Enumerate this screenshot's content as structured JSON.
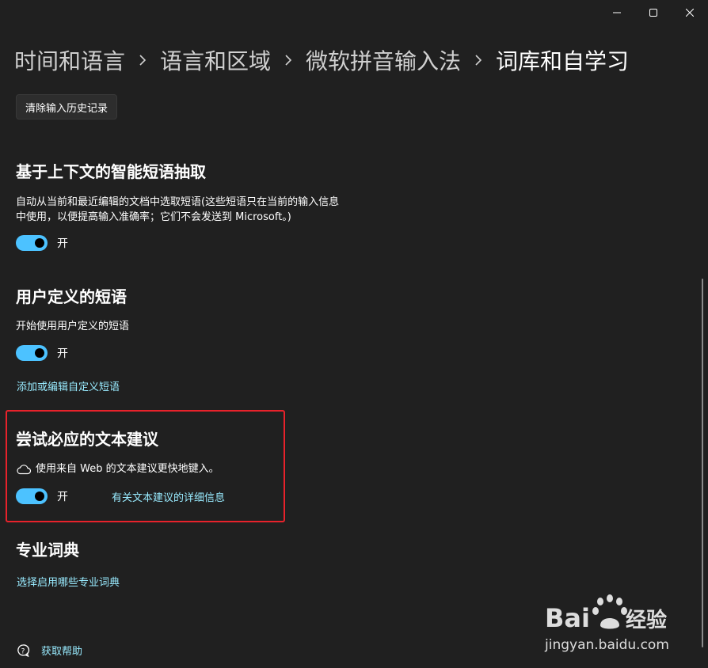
{
  "titlebar": {
    "minimize_icon": "minimize-icon",
    "maximize_icon": "maximize-icon",
    "close_icon": "close-icon"
  },
  "breadcrumb": {
    "items": [
      "时间和语言",
      "语言和区域",
      "微软拼音输入法",
      "词库和自学习"
    ]
  },
  "clear_history_button": "清除输入历史记录",
  "context_phrases": {
    "title": "基于上下文的智能短语抽取",
    "desc_line1": "自动从当前和最近编辑的文档中选取短语(这些短语只在当前的输入信息",
    "desc_line2": "中使用，以便提高输入准确率；它们不会发送到 Microsoft。)",
    "toggle_label": "开",
    "toggle_on": true
  },
  "user_phrases": {
    "title": "用户定义的短语",
    "desc": "开始使用用户定义的短语",
    "toggle_label": "开",
    "toggle_on": true,
    "link": "添加或编辑自定义短语"
  },
  "bing_suggestions": {
    "title": "尝试必应的文本建议",
    "desc": "使用来自 Web 的文本建议更快地键入。",
    "icon": "cloud-icon",
    "toggle_label": "开",
    "toggle_on": true,
    "link": "有关文本建议的详细信息",
    "highlight_color": "#e8222b"
  },
  "dictionaries": {
    "title": "专业词典",
    "link": "选择启用哪些专业词典"
  },
  "help": {
    "label": "获取帮助",
    "icon": "help-chat-icon"
  },
  "watermark": {
    "brand_text": "Bai",
    "brand_text2": "经验",
    "url": "jingyan.baidu.com"
  },
  "colors": {
    "background": "#202020",
    "accent": "#4cc2ff",
    "link": "#99ebff"
  }
}
